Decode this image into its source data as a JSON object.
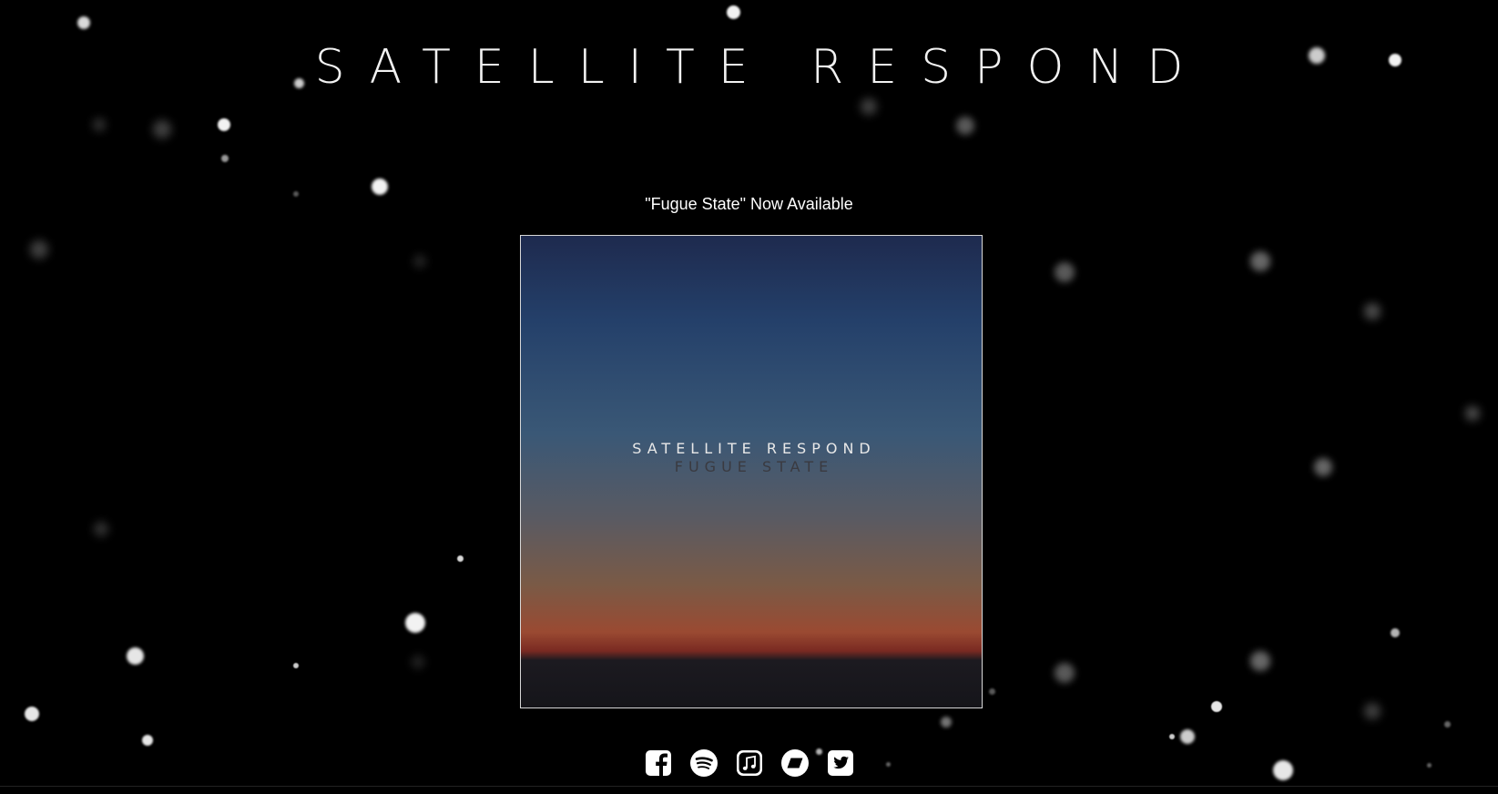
{
  "header": {
    "band_name": "SATELLITE RESPOND"
  },
  "release": {
    "announcement": "\"Fugue State\" Now Available",
    "cover_band_name": "SATELLITE RESPOND",
    "cover_album_title": "FUGUE STATE"
  },
  "social": [
    {
      "name": "facebook",
      "icon": "facebook-icon"
    },
    {
      "name": "spotify",
      "icon": "spotify-icon"
    },
    {
      "name": "itunes",
      "icon": "itunes-icon"
    },
    {
      "name": "bandcamp",
      "icon": "bandcamp-icon"
    },
    {
      "name": "twitter",
      "icon": "twitter-icon"
    }
  ],
  "colors": {
    "background": "#000000",
    "text": "#ffffff",
    "album_border": "#d8d8d8"
  }
}
